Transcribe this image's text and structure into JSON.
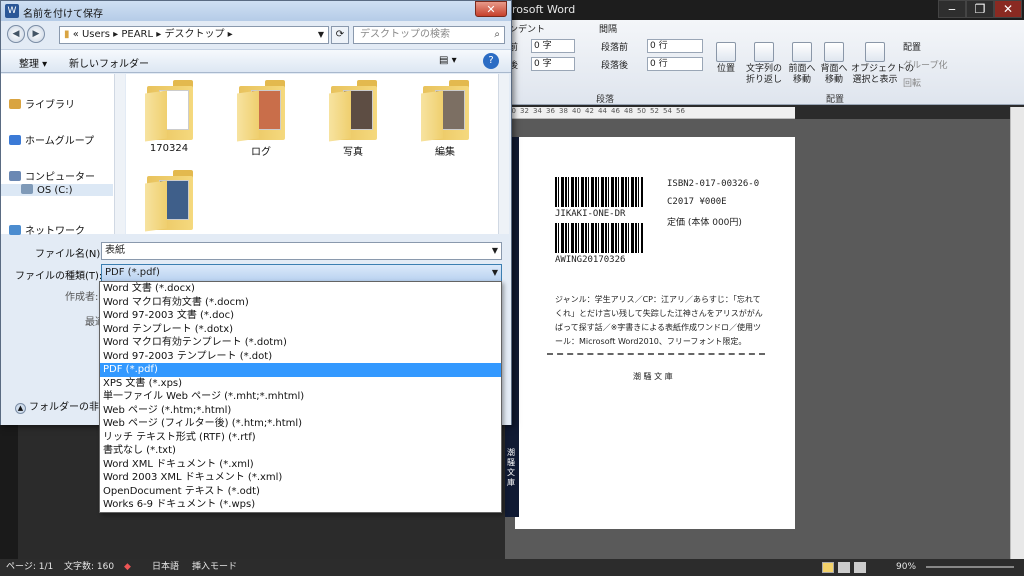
{
  "word": {
    "title": "rosoft Word",
    "window_controls": [
      "‒",
      "❐",
      "✕"
    ],
    "ribbon": {
      "indent_label": "ンデント",
      "spacing_label": "間隔",
      "before_label": "段落前",
      "after_label": "段落後",
      "indent_left_label": "前",
      "indent_right_label": "後",
      "indent_left_value": "0 字",
      "indent_right_value": "0 字",
      "before_value": "0 行",
      "after_value": "0 行",
      "paragraph_group": "段落",
      "arrange_group": "配置",
      "buttons": [
        {
          "label": "位置"
        },
        {
          "label": "文字列の\n折り返し"
        },
        {
          "label": "前面へ\n移動"
        },
        {
          "label": "背面へ\n移動"
        },
        {
          "label": "オブジェクトの\n選択と表示"
        }
      ],
      "small_buttons": [
        "配置",
        "グループ化",
        "回転"
      ]
    },
    "ruler": [
      "30",
      "32",
      "34",
      "36",
      "38",
      "40",
      "42",
      "44",
      "46",
      "48",
      "50",
      "52",
      "54",
      "56"
    ],
    "document": {
      "isbn": "ISBN2-017-00326-0",
      "c_code": "C2017 ¥000E",
      "price": "定価 (本体 000円)",
      "barcode1_text": "JIKAKI-ONE-DR",
      "barcode2_text": "AWING20170326",
      "synopsis": "ジャンル：学生アリス／CP：江アリ／あらすじ：「忘れてくれ」とだけ言い残して失踪した江神さんをアリスががんばって探す話／※字書きによる表紙作成ワンドロ／使用ツール：Microsoft Word2010、フリーフォント限定。",
      "publisher": "潮 騒 文 庫",
      "spine_text": "潮騒文庫"
    },
    "statusbar": {
      "page": "ページ: 1/1",
      "words": "文字数: 160",
      "language": "日本語",
      "mode": "挿入モード",
      "zoom": "90%"
    }
  },
  "dialog": {
    "title": "名前を付けて保存",
    "close": "✕",
    "address": "«  Users  ▸  PEARL  ▸  デスクトップ  ▸",
    "search_placeholder": "デスクトップの検索",
    "toolbar": {
      "organize": "整理 ▾",
      "new_folder": "新しいフォルダー"
    },
    "nav": [
      {
        "label": "ライブラリ",
        "color": "#d9a441"
      },
      {
        "label": "ホームグループ",
        "color": "#3b7ad6"
      },
      {
        "label": "コンピューター",
        "color": "#6b88b3"
      },
      {
        "label": "OS (C:)",
        "color": "#7f9ab8"
      },
      {
        "label": "ネットワーク",
        "color": "#4c8ccf"
      }
    ],
    "folders": [
      {
        "label": "170324"
      },
      {
        "label": "ログ"
      },
      {
        "label": "写真"
      },
      {
        "label": "編集"
      },
      {
        "label": ""
      }
    ],
    "filename_label": "ファイル名(N):",
    "filename_value": "表紙",
    "filetype_label": "ファイルの種類(T):",
    "filetype_value": "PDF (*.pdf)",
    "author_label": "作成者:",
    "optimize_label": "最適",
    "hide_folders": "フォルダーの非表",
    "filetype_options": [
      "Word 文書 (*.docx)",
      "Word マクロ有効文書 (*.docm)",
      "Word 97-2003 文書 (*.doc)",
      "Word テンプレート (*.dotx)",
      "Word マクロ有効テンプレート (*.dotm)",
      "Word 97-2003 テンプレート (*.dot)",
      "PDF (*.pdf)",
      "XPS 文書 (*.xps)",
      "単一ファイル Web ページ (*.mht;*.mhtml)",
      "Web ページ (*.htm;*.html)",
      "Web ページ (フィルター後) (*.htm;*.html)",
      "リッチ テキスト形式 (RTF) (*.rtf)",
      "書式なし (*.txt)",
      "Word XML ドキュメント (*.xml)",
      "Word 2003 XML ドキュメント (*.xml)",
      "OpenDocument テキスト (*.odt)",
      "Works 6-9 ドキュメント (*.wps)"
    ],
    "selected_option": 6
  },
  "colors": {
    "selection": "#3399ff",
    "dialog_bg": "#e3ebf5"
  }
}
